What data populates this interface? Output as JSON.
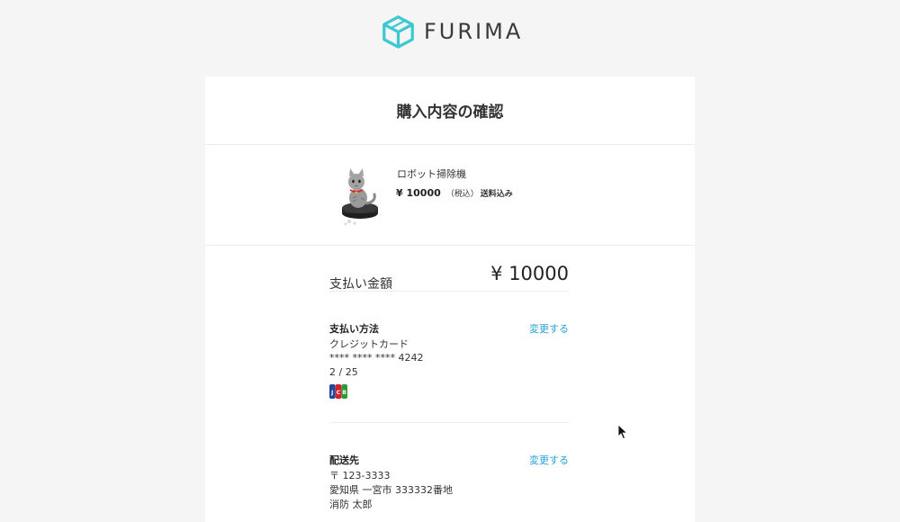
{
  "header": {
    "brand": "FURIMA",
    "logo_icon": "cube-logo-icon",
    "brand_color": "#3cc8d2"
  },
  "page": {
    "title": "購入内容の確認"
  },
  "item": {
    "name": "ロボット掃除機",
    "price": "¥ 10000",
    "tax_label": "（税込）",
    "shipping_label": "送料込み",
    "thumbnail_icon": "cat-on-robot-vacuum-image"
  },
  "total": {
    "label": "支払い金額",
    "value": "¥ 10000"
  },
  "payment": {
    "title": "支払い方法",
    "change_label": "変更する",
    "method": "クレジットカード",
    "card_number": "**** **** **** 4242",
    "expiry": "2 / 25",
    "card_brand_icon": "jcb-card-icon"
  },
  "shipping": {
    "title": "配送先",
    "change_label": "変更する",
    "postal": "〒 123-3333",
    "address": "愛知県 一宮市 333332番地",
    "name": "消防 太郎"
  },
  "colors": {
    "link": "#2aa0d8",
    "background": "#f5f5f5",
    "panel": "#ffffff"
  }
}
